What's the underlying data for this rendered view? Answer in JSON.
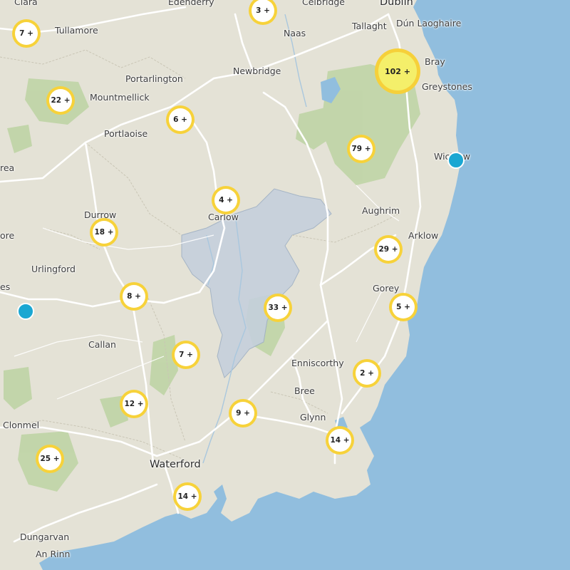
{
  "colors": {
    "land": "#e4e2d6",
    "sea": "#91bede",
    "forest": "#b9d1a0",
    "roads": "#ffffff",
    "region": "#c5d0dc",
    "cluster_ring": "#f7d23a",
    "point": "#1aa7d2"
  },
  "places": {
    "clara": "Clara",
    "edenderry": "Edenderry",
    "celbridge": "Celbridge",
    "dublin": "Dublin",
    "tullamore": "Tullamore",
    "tallaght": "Tallaght",
    "dun_laoghaire": "Dún Laoghaire",
    "naas": "Naas",
    "newbridge": "Newbridge",
    "portarlington": "Portarlington",
    "bray": "Bray",
    "mountmellick": "Mountmellick",
    "greystones": "Greystones",
    "portlaoise": "Portlaoise",
    "wicklow": "Wicklow",
    "rea": "rea",
    "carlow": "Carlow",
    "durrow": "Durrow",
    "aughrim": "Aughrim",
    "ore": "ore",
    "arklow": "Arklow",
    "urlingford": "Urlingford",
    "es": "es",
    "gorey": "Gorey",
    "callan": "Callan",
    "enniscorthy": "Enniscorthy",
    "bree": "Bree",
    "glynn": "Glynn",
    "clonmel": "Clonmel",
    "waterford": "Waterford",
    "dungarvan": "Dungarvan",
    "an_rinn": "An Rinn"
  },
  "clusters": [
    "3 +",
    "7 +",
    "22 +",
    "6 +",
    "102 +",
    "79 +",
    "4 +",
    "18 +",
    "29 +",
    "8 +",
    "33 +",
    "5 +",
    "7 +",
    "2 +",
    "12 +",
    "9 +",
    "14 +",
    "25 +",
    "14 +"
  ]
}
